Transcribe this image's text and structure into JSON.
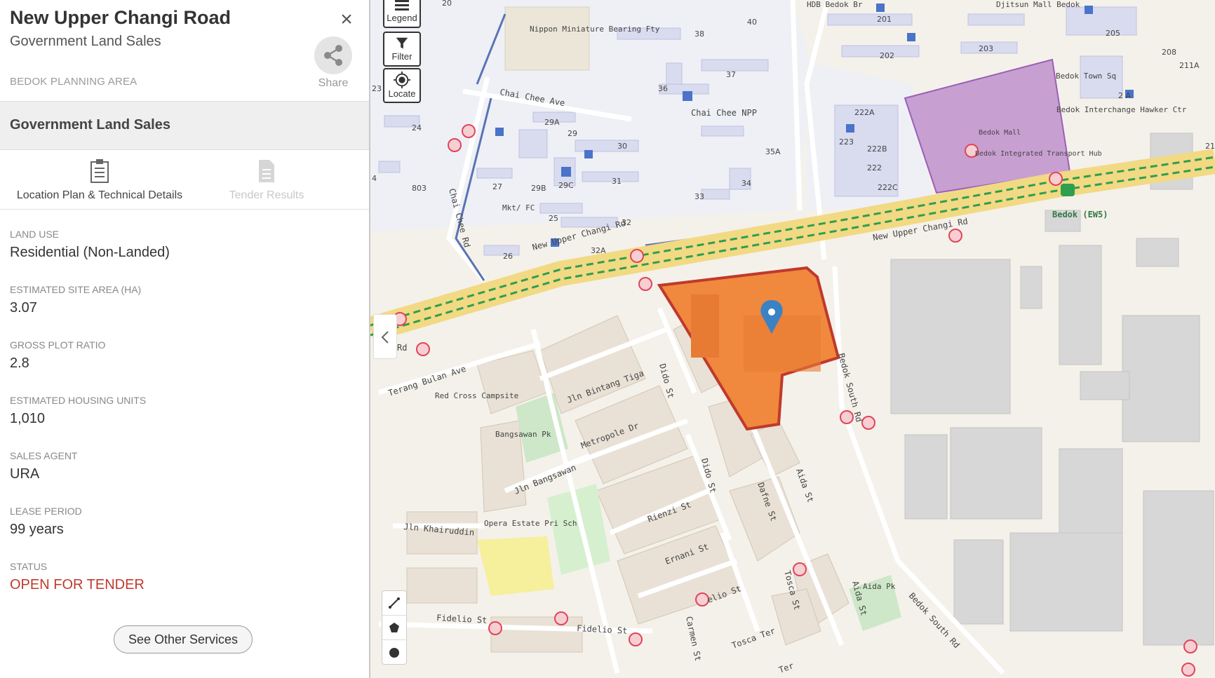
{
  "panel": {
    "title": "New Upper Changi Road",
    "subtitle": "Government Land Sales",
    "share_label": "Share",
    "planning_area": "BEDOK PLANNING AREA",
    "section_title": "Government Land Sales",
    "tabs": [
      {
        "label": "Location Plan & Technical Details",
        "icon": "clipboard-icon",
        "active": true
      },
      {
        "label": "Tender Results",
        "icon": "document-icon",
        "active": false
      }
    ],
    "fields": [
      {
        "key": "LAND USE",
        "value": "Residential (Non-Landed)"
      },
      {
        "key": "ESTIMATED SITE AREA (HA)",
        "value": "3.07"
      },
      {
        "key": "GROSS PLOT RATIO",
        "value": "2.8"
      },
      {
        "key": "ESTIMATED HOUSING UNITS",
        "value": "1,010"
      },
      {
        "key": "SALES AGENT",
        "value": "URA"
      },
      {
        "key": "LEASE PERIOD",
        "value": "99 years"
      },
      {
        "key": "STATUS",
        "value": "OPEN FOR TENDER"
      }
    ],
    "services_button": "See Other Services",
    "status_color": "#c0392b"
  },
  "map_controls": {
    "legend": "Legend",
    "filter": "Filter",
    "locate": "Locate"
  },
  "map": {
    "colors": {
      "site": "#f0883e",
      "site_border": "#c0392b",
      "mall": "#b57cc6",
      "road": "#f5dc8c",
      "mrt": "#3ca35a",
      "building": "#d6d6d6",
      "hdb": "#d9dbef"
    },
    "labels": {
      "new_upper_changi_rd_w": "New Upper Changi Rd",
      "new_upper_changi_rd_e": "New Upper Changi Rd",
      "chai_chee_ave": "Chai Chee Ave",
      "chai_chee_rd": "Chai Chee Rd",
      "chai_chee_npp": "Chai Chee NPP",
      "nippon": "Nippon Miniature Bearing Fty",
      "bedok_mall": "Bedok Mall",
      "bedok_hub": "Bedok Integrated Transport Hub",
      "bedok_mrt": "Bedok (EW5)",
      "bedok_town_sq": "Bedok Town Sq",
      "bedok_interchange": "Bedok Interchange Hawker Ctr",
      "bedok_south_rd": "Bedok South Rd",
      "bedok_south_rd_2": "Bedok South Rd",
      "terang_bulan": "Terang Bulan Ave",
      "red_cross": "Red Cross Campsite",
      "jln_bintang_tiga": "Jln Bintang Tiga",
      "dido_st": "Dido St",
      "dido_st_2": "Dido St",
      "metropole": "Metropole Dr",
      "bangsawan_pk": "Bangsawan Pk",
      "jln_bangsawan": "Jln Bangsawan",
      "jln_khairuddin": "Jln Khairuddin",
      "opera_estate": "Opera Estate Pri Sch",
      "rienzi": "Rienzi St",
      "ernani": "Ernani St",
      "dafne": "Dafne St",
      "aida_st": "Aida St",
      "aida_st_2": "Aida St",
      "aida_pk": "Aida Pk",
      "tosca_st": "Tosca St",
      "tosca_ter": "Tosca Ter",
      "carmen": "Carmen St",
      "fidelio_1": "Fidelio St",
      "fidelio_2": "Fidelio St",
      "otello": "elio St",
      "ter": "Ter",
      "hdb_bedok": "HDB Bedok Br",
      "djitsun": "Djitsun Mall Bedok",
      "mkt_fc": "Mkt/ FC",
      "rd_left": "Rd",
      "blk_20": "20",
      "blk_38": "38",
      "blk_40": "40",
      "blk_37": "37",
      "blk_36": "36",
      "blk_29a": "29A",
      "blk_29": "29",
      "blk_30": "30",
      "blk_29b": "29B",
      "blk_29c": "29C",
      "blk_31": "31",
      "blk_27": "27",
      "blk_25": "25",
      "blk_32": "32",
      "blk_32a": "32A",
      "blk_26": "26",
      "blk_33": "33",
      "blk_34": "34",
      "blk_35a": "35A",
      "blk_24": "24",
      "blk_803": "803",
      "blk_23": "23",
      "blk_4": "4",
      "blk_201": "201",
      "blk_202": "202",
      "blk_203": "203",
      "blk_205": "205",
      "blk_208": "208",
      "blk_211a": "211A",
      "blk_2a": "2 A",
      "blk_21": "21",
      "blk_222a": "222A",
      "blk_223": "223",
      "blk_222b": "222B",
      "blk_222": "222",
      "blk_222c": "222C"
    }
  }
}
